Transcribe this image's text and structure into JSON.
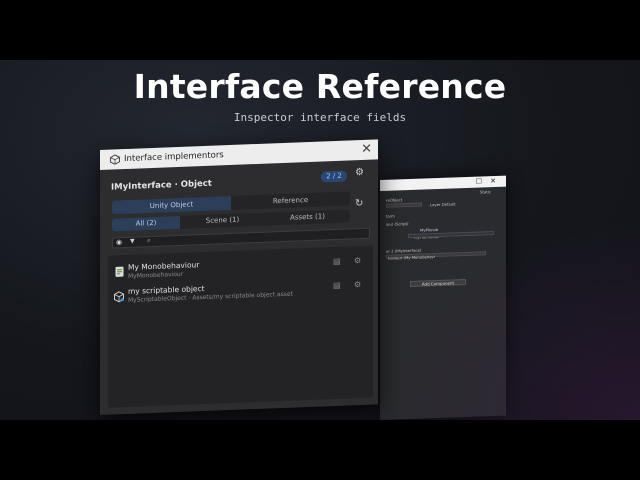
{
  "hero": {
    "title": "Interface Reference",
    "subtitle": "Inspector interface fields"
  },
  "window": {
    "title": "Interface implementors",
    "header": "IMyInterface · Object",
    "count": "2 / 2",
    "tabs": [
      {
        "label": "Unity Object",
        "active": true
      },
      {
        "label": "Reference",
        "active": false
      }
    ],
    "filters": [
      {
        "label": "All (2)",
        "active": true
      },
      {
        "label": "Scene (1)",
        "active": false
      },
      {
        "label": "Assets (1)",
        "active": false
      }
    ],
    "search_placeholder": "",
    "items": [
      {
        "name": "My Monobehaviour",
        "sub": "MyMonobehaviour",
        "icon": "script-icon"
      },
      {
        "name": "my scriptable object",
        "sub": "MyScriptableObject · Assets/my scriptable object.asset",
        "icon": "scriptable-object-icon"
      }
    ]
  },
  "inspector": {
    "rows": [
      "Static",
      "reObject",
      "Layer  Default",
      "form",
      "iour (Script)",
      "MyMonob",
      "MyPlainClass",
      "er 2 (IMyInterface)",
      "haviour (My Monobehavi"
    ],
    "add_component": "Add Component"
  },
  "colors": {
    "accent": "#2c3e58",
    "badge": "#2a4773",
    "background": "#15171d"
  }
}
